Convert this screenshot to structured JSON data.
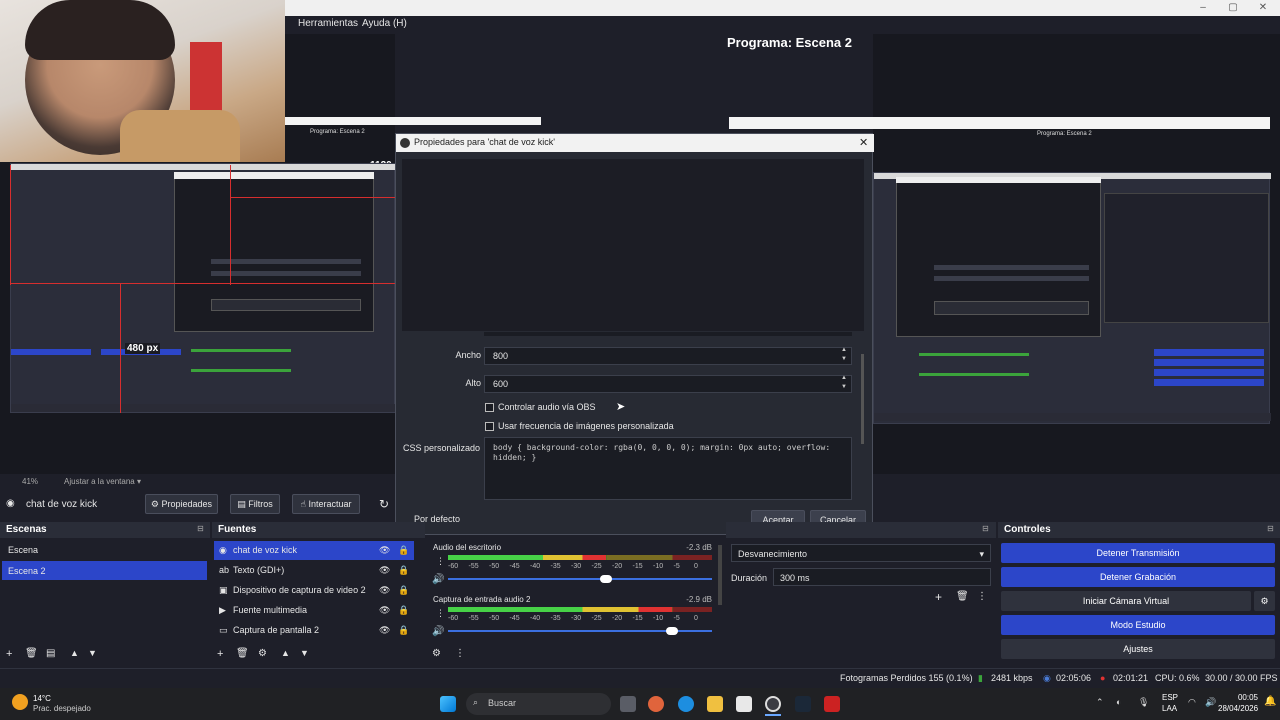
{
  "menu": {
    "tools": "Herramientas",
    "help": "Ayuda (H)"
  },
  "program_header": "Programa: Escena 2",
  "preview_controls": {
    "zoom": "41%",
    "fit": "Ajustar a la ventana"
  },
  "source_toolbar": {
    "source_name": "chat de voz kick",
    "properties": "Propiedades",
    "filters": "Filtros",
    "interact": "Interactuar"
  },
  "dialog": {
    "title": "Propiedades para 'chat de voz kick'",
    "width_label": "Ancho",
    "width_value": "800",
    "height_label": "Alto",
    "height_value": "600",
    "audio_checkbox": "Controlar audio vía OBS",
    "fps_checkbox": "Usar frecuencia de imágenes personalizada",
    "css_label": "CSS personalizado",
    "css_value": "body { background-color: rgba(0, 0, 0, 0); margin: 0px auto; overflow: hidden; }",
    "defaults_button": "Por defecto",
    "ok_button": "Aceptar",
    "cancel_button": "Cancelar"
  },
  "scenes": {
    "title": "Escenas",
    "items": [
      "Escena",
      "Escena 2"
    ],
    "selected": "Escena 2"
  },
  "sources": {
    "title": "Fuentes",
    "items": [
      {
        "name": "chat de voz kick",
        "icon": "globe-icon"
      },
      {
        "name": "Texto (GDI+)",
        "icon": "text-icon"
      },
      {
        "name": "Dispositivo de captura de video 2",
        "icon": "camera-icon"
      },
      {
        "name": "Fuente multimedia",
        "icon": "play-icon"
      },
      {
        "name": "Captura de pantalla 2",
        "icon": "monitor-icon"
      }
    ]
  },
  "mixer": {
    "channels": [
      {
        "name": "Audio del escritorio",
        "db": "-2.3 dB",
        "level": 0.6
      },
      {
        "name": "Captura de entrada audio 2",
        "db": "-2.9 dB",
        "level": 0.85
      }
    ],
    "ticks": [
      "-60",
      "-55",
      "-50",
      "-45",
      "-40",
      "-35",
      "-30",
      "-25",
      "-20",
      "-15",
      "-10",
      "-5",
      "0"
    ]
  },
  "transitions": {
    "type": "Desvanecimiento",
    "duration_label": "Duración",
    "duration_value": "300 ms"
  },
  "controls": {
    "title": "Controles",
    "buttons": [
      "Detener Transmisión",
      "Detener Grabación",
      "Iniciar Cámara Virtual",
      "Modo Estudio",
      "Ajustes"
    ]
  },
  "status": {
    "dropped": "Fotogramas Perdidos 155 (0.1%)",
    "bitrate": "2481 kbps",
    "stream_time": "02:05:06",
    "rec_time": "02:01:21",
    "cpu": "CPU: 0.6%",
    "fps": "30.00 / 30.00 FPS"
  },
  "taskbar": {
    "weather_temp": "14°C",
    "weather_desc": "Prac. despejado",
    "search": "Buscar",
    "lang": "ESP",
    "lang2": "LAA",
    "time": "00:05",
    "date": "28/04/2026"
  },
  "preview_overlay": {
    "size_label": "480 px"
  }
}
